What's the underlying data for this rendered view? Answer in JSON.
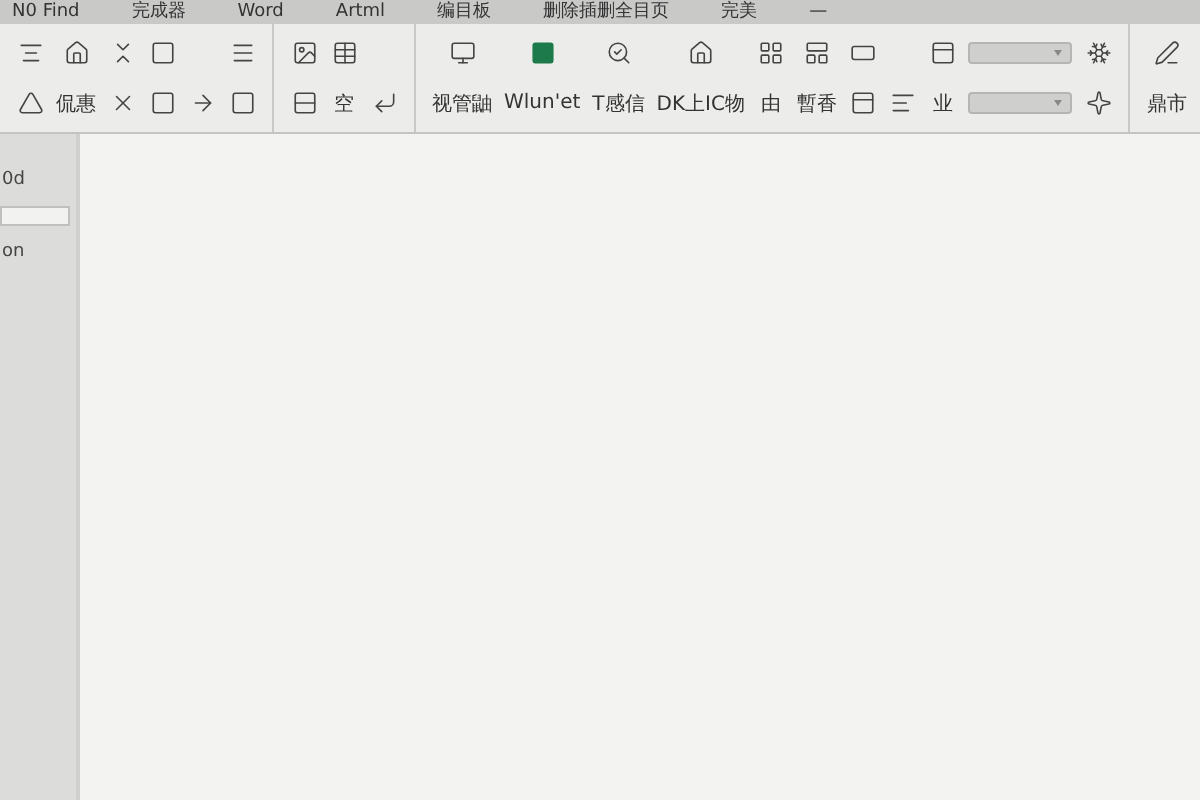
{
  "menu_bar": {
    "items": [
      "N0 Find",
      "完成器",
      "Word",
      "Artml",
      "编目板",
      "删除插删全目页",
      "完美",
      "—"
    ]
  },
  "toolbar": {
    "groups": [
      {
        "columns": [
          {
            "top": {
              "kind": "icon"
            },
            "bottom": {
              "kind": "icon"
            }
          },
          {
            "top": {
              "kind": "icon"
            },
            "bottom": {
              "kind": "text",
              "label": "侃惠"
            }
          },
          {
            "top": {
              "kind": "icon"
            },
            "bottom": {
              "kind": "icon"
            }
          },
          {
            "top": {
              "kind": "icon"
            },
            "bottom": {
              "kind": "icon"
            }
          },
          {
            "top": {
              "kind": "none"
            },
            "bottom": {
              "kind": "icon"
            }
          },
          {
            "top": {
              "kind": "icon"
            },
            "bottom": {
              "kind": "icon"
            }
          }
        ]
      },
      {
        "columns": [
          {
            "top": {
              "kind": "icon"
            },
            "bottom": {
              "kind": "icon"
            }
          },
          {
            "top": {
              "kind": "icon"
            },
            "bottom": {
              "kind": "text",
              "label": "空"
            }
          },
          {
            "top": {
              "kind": "none"
            },
            "bottom": {
              "kind": "icon"
            }
          }
        ]
      },
      {
        "columns": [
          {
            "top": {
              "kind": "icon"
            },
            "bottom": {
              "kind": "text",
              "label": "视管鼬"
            }
          },
          {
            "top": {
              "kind": "icon"
            },
            "bottom": {
              "kind": "text",
              "label": "Wlun'et"
            }
          },
          {
            "top": {
              "kind": "icon"
            },
            "bottom": {
              "kind": "text",
              "label": "T感信"
            }
          },
          {
            "top": {
              "kind": "icon"
            },
            "bottom": {
              "kind": "text",
              "label": "DK上IC物"
            }
          },
          {
            "top": {
              "kind": "icon"
            },
            "bottom": {
              "kind": "text",
              "label": "由"
            }
          },
          {
            "top": {
              "kind": "icon"
            },
            "bottom": {
              "kind": "text",
              "label": "暫香"
            }
          },
          {
            "top": {
              "kind": "icon"
            },
            "bottom": {
              "kind": "icon"
            }
          },
          {
            "top": {
              "kind": "none"
            },
            "bottom": {
              "kind": "icon"
            }
          },
          {
            "top": {
              "kind": "icon"
            },
            "bottom": {
              "kind": "text",
              "label": "业"
            }
          },
          {
            "top": {
              "kind": "dropdown"
            },
            "bottom": {
              "kind": "dropdown"
            }
          },
          {
            "top": {
              "kind": "icon"
            },
            "bottom": {
              "kind": "icon"
            }
          }
        ]
      },
      {
        "columns": [
          {
            "top": {
              "kind": "icon"
            },
            "bottom": {
              "kind": "text",
              "label": "鼎市"
            }
          }
        ]
      }
    ]
  },
  "sidebar": {
    "items": [
      "0d",
      "on"
    ]
  }
}
